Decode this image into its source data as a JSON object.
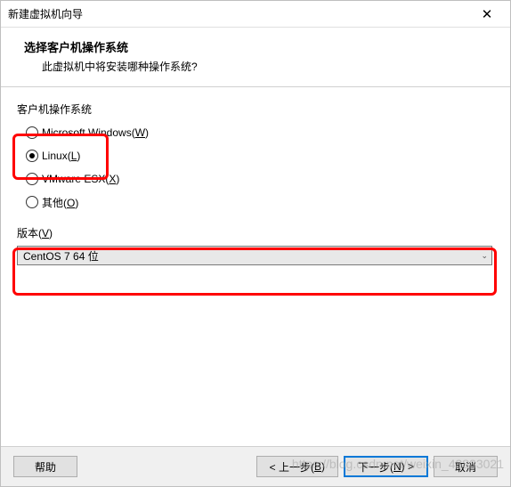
{
  "title": "新建虚拟机向导",
  "header": {
    "title": "选择客户机操作系统",
    "subtitle": "此虚拟机中将安装哪种操作系统?"
  },
  "os_group": {
    "label": "客户机操作系统",
    "options": {
      "windows_pre": "Microsoft Windows(",
      "windows_key": "W",
      "windows_post": ")",
      "linux_pre": "Linux(",
      "linux_key": "L",
      "linux_post": ")",
      "esx_pre": "VMware ESX(",
      "esx_key": "X",
      "esx_post": ")",
      "other_pre": "其他(",
      "other_key": "O",
      "other_post": ")"
    }
  },
  "version": {
    "label_pre": "版本(",
    "label_key": "V",
    "label_post": ")",
    "selected": "CentOS 7 64 位"
  },
  "buttons": {
    "help": "帮助",
    "back_pre": "< 上一步(",
    "back_key": "B",
    "back_post": ")",
    "next_pre": "下一步(",
    "next_key": "N",
    "next_post": ") >",
    "cancel": "取消"
  },
  "watermark": "https://blog.csdn.net/weixin_43833021"
}
